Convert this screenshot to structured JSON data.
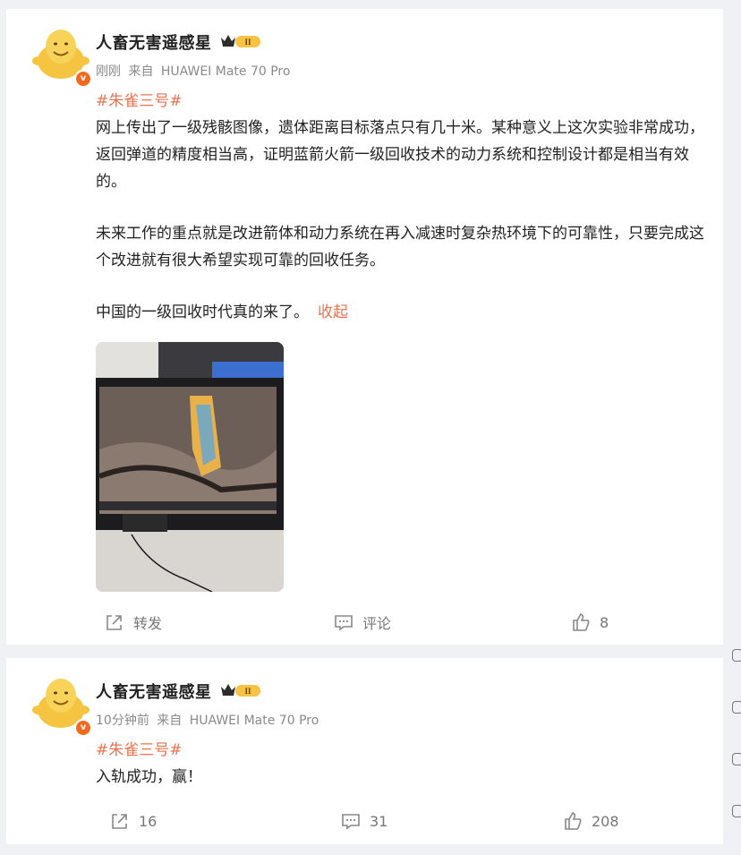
{
  "posts": [
    {
      "author": "人畜无害遥感星",
      "level_badge": "II",
      "time": "刚刚",
      "source_prefix": "来自",
      "device": "HUAWEI Mate 70 Pro",
      "topic": "#朱雀三号#",
      "paragraphs": [
        "网上传出了一级残骸图像，遗体距离目标落点只有几十米。某种意义上这次实验非常成功，返回弹道的精度相当高，证明蓝箭火箭一级回收技术的动力系统和控制设计都是相当有效的。",
        "未来工作的重点就是改进箭体和动力系统在再入减速时复杂热环境下的可靠性，只要完成这个改进就有很大希望实现可靠的回收任务。",
        "中国的一级回收时代真的来了。"
      ],
      "collapse_label": "收起",
      "actions": {
        "repost": "转发",
        "comment": "评论",
        "like": "8"
      }
    },
    {
      "author": "人畜无害遥感星",
      "level_badge": "II",
      "time": "10分钟前",
      "source_prefix": "来自",
      "device": "HUAWEI Mate 70 Pro",
      "topic": "#朱雀三号#",
      "text": "入轨成功，赢！",
      "actions": {
        "repost": "16",
        "comment": "31",
        "like": "208"
      }
    }
  ],
  "colors": {
    "topic": "#eb7350",
    "verified_badge": "#f36a1f",
    "background": "#f0f1f4"
  }
}
